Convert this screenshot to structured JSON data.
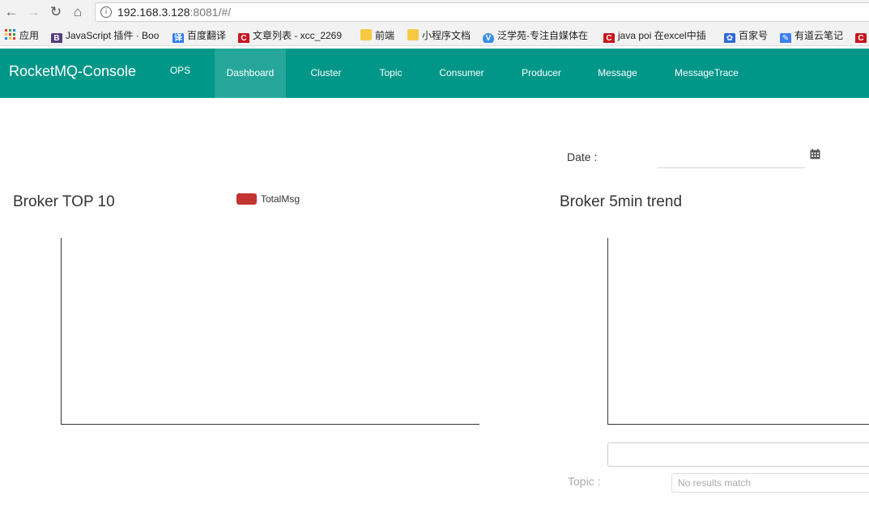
{
  "browser": {
    "url_host": "192.168.3.128",
    "url_rest": ":8081/#/",
    "bookmarks": [
      {
        "label": "应用",
        "icon": "apps-grid-icon",
        "color": "#e53935"
      },
      {
        "label": "JavaScript 插件 · Boo",
        "icon": "bootstrap-icon",
        "color": "#563d7c",
        "glyph": "B"
      },
      {
        "label": "百度翻译",
        "icon": "baidu-translate-icon",
        "color": "#2f7df6",
        "glyph": "译"
      },
      {
        "label": "文章列表 - xcc_2269",
        "icon": "csdn-icon",
        "color": "#c9161d",
        "glyph": "C"
      },
      {
        "label": "前端",
        "icon": "folder-icon",
        "color": "#f6c945"
      },
      {
        "label": "小程序文档",
        "icon": "folder-icon",
        "color": "#f6c945"
      },
      {
        "label": "泛学苑-专注自媒体在",
        "icon": "site-icon",
        "color": "#3a8ee6",
        "glyph": "V"
      },
      {
        "label": "java poi 在excel中插",
        "icon": "csdn-icon",
        "color": "#c9161d",
        "glyph": "C"
      },
      {
        "label": "百家号",
        "icon": "baidu-paw-icon",
        "color": "#2f6bd8",
        "glyph": "✿"
      },
      {
        "label": "有道云笔记",
        "icon": "youdao-note-icon",
        "color": "#3b7ff3",
        "glyph": "✎"
      },
      {
        "label": "",
        "icon": "csdn-icon",
        "color": "#c9161d",
        "glyph": "C"
      }
    ]
  },
  "navbar": {
    "brand": "RocketMQ-Console",
    "items": [
      "OPS",
      "Dashboard",
      "Cluster",
      "Topic",
      "Consumer",
      "Producer",
      "Message",
      "MessageTrace"
    ],
    "active": "Dashboard",
    "color": "#009688"
  },
  "date": {
    "label": "Date :",
    "value": ""
  },
  "charts": {
    "top10_title": "Broker TOP 10",
    "trend_title": "Broker 5min trend"
  },
  "chart_data": [
    {
      "type": "bar",
      "title": "Broker TOP 10",
      "series": [
        {
          "name": "TotalMsg",
          "values": [],
          "color": "#c23531"
        }
      ],
      "categories": []
    },
    {
      "type": "line",
      "title": "Broker 5min trend",
      "series": [],
      "x": []
    }
  ],
  "topic": {
    "label": "Topic :",
    "select_placeholder": "No results match"
  }
}
